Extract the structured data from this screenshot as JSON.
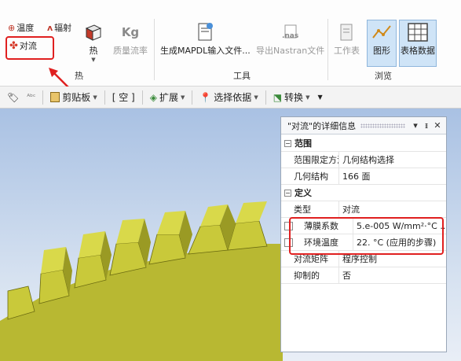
{
  "ribbon": {
    "heat_group": {
      "label": "热",
      "temperature": "温度",
      "radiation": "辐射",
      "convection": "对流",
      "heat": "热",
      "mass_flow": "质量流率"
    },
    "tools_group": {
      "label": "工具",
      "generate_mapdl": "生成MAPDL输入文件...",
      "export_nastran": "导出Nastran文件",
      "nas_tag": ".nas"
    },
    "browse_group": {
      "label": "浏览",
      "worksheet": "工作表",
      "graphics": "图形",
      "tabular": "表格数据"
    }
  },
  "toolbar": {
    "clipboard": "剪贴板",
    "empty": "[ 空 ]",
    "extend": "扩展",
    "select_by": "选择依据",
    "convert": "转换"
  },
  "details": {
    "title": "\"对流\"的详细信息",
    "sections": {
      "scope": "范围",
      "definition": "定义"
    },
    "scope_rows": [
      {
        "name": "范围限定方法",
        "value": "几何结构选择"
      },
      {
        "name": "几何结构",
        "value": "166 面"
      }
    ],
    "definition_rows": [
      {
        "name": "类型",
        "value": "对流"
      },
      {
        "name": "薄膜系数",
        "value": "5.e-005 W/mm²·°C ..."
      },
      {
        "name": "环境温度",
        "value": "22. °C  (应用的步骤)"
      },
      {
        "name": "对流矩阵",
        "value": "程序控制"
      },
      {
        "name": "抑制的",
        "value": "否"
      }
    ]
  },
  "colors": {
    "highlight": "#e02020",
    "gear": "#b8b832"
  }
}
